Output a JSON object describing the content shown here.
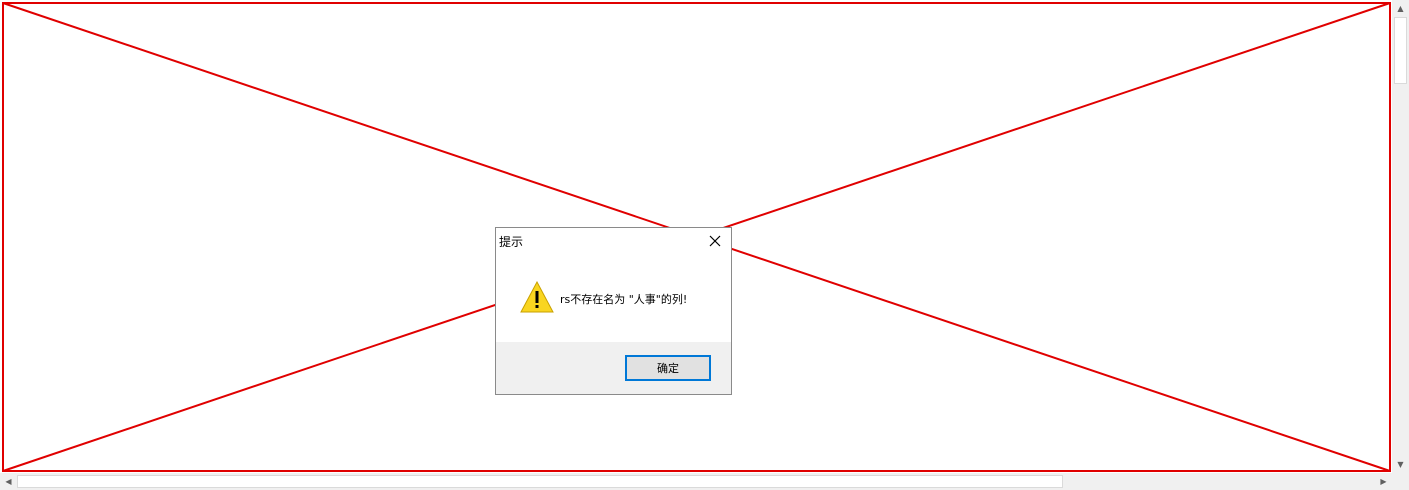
{
  "dialog": {
    "title": "提示",
    "message": "rs不存在名为 \"人事\"的列!",
    "ok_label": "确定",
    "icon": "warning-icon",
    "close_icon": "close-icon"
  },
  "placeholder": {
    "icon": "broken-image-placeholder",
    "line_color": "#e00000"
  },
  "colors": {
    "accent": "#0078d7",
    "warning": "#f9d520"
  }
}
